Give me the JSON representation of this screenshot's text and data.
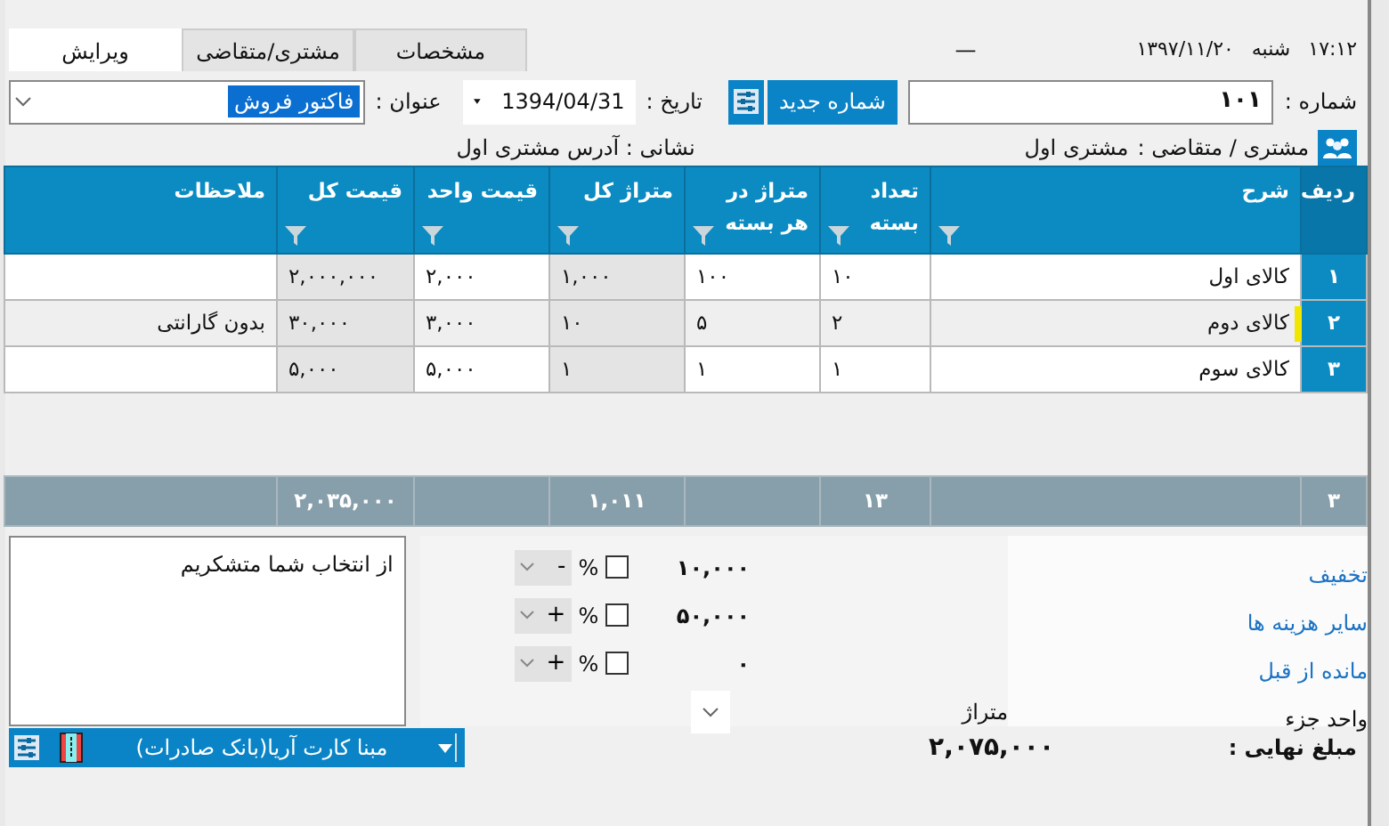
{
  "header": {
    "time": "۱۷:۱۲",
    "weekday": "شنبه",
    "date": "۱۳۹۷/۱۱/۲۰",
    "minimize": "—"
  },
  "tabs": [
    {
      "label": "مشخصات",
      "selected": false
    },
    {
      "label": "مشتری/متقاضی",
      "selected": false
    },
    {
      "label": "ویرایش",
      "selected": true
    }
  ],
  "form": {
    "number_label": "شماره :",
    "number": "۱۰۱",
    "new_number_button": "شماره جدید",
    "date_label": "تاریخ :",
    "date": "1394/04/31",
    "title_label": "عنوان :",
    "title": "فاکتور فروش",
    "customer_label": "مشتری / متقاضی :",
    "customer": "مشتری اول",
    "address_label": "نشانی :",
    "address": "آدرس مشتری اول"
  },
  "table": {
    "columns": [
      {
        "title": "ردیف",
        "filter": false,
        "computed": false
      },
      {
        "title": "شرح",
        "filter": true,
        "computed": false
      },
      {
        "title": "تعداد بسته",
        "filter": true,
        "computed": false
      },
      {
        "title": "متراژ در هر بسته",
        "filter": true,
        "computed": false
      },
      {
        "title": "متراژ کل",
        "filter": true,
        "computed": true
      },
      {
        "title": "قیمت واحد",
        "filter": true,
        "computed": false
      },
      {
        "title": "قیمت کل",
        "filter": true,
        "computed": true
      },
      {
        "title": "ملاحظات",
        "filter": false,
        "computed": false
      }
    ],
    "totals": {
      "row_count": "۳",
      "packs": "۱۳",
      "total_area": "۱,۰۱۱",
      "total_price": "۲,۰۳۵,۰۰۰"
    },
    "rows": [
      {
        "selected": false,
        "cells": [
          "۱",
          "کالای اول",
          "۱۰",
          "۱۰۰",
          "۱,۰۰۰",
          "۲,۰۰۰",
          "۲,۰۰۰,۰۰۰",
          null
        ]
      },
      {
        "selected": true,
        "cells": [
          "۲",
          "کالای دوم",
          "۲",
          "۵",
          "۱۰",
          "۳,۰۰۰",
          "۳۰,۰۰۰",
          "بدون گارانتی"
        ]
      },
      {
        "selected": false,
        "cells": [
          "۳",
          "کالای سوم",
          "۱",
          "۱",
          "۱",
          "۵,۰۰۰",
          "۵,۰۰۰",
          null
        ]
      }
    ]
  },
  "adjustments": [
    {
      "label": "تخفیف",
      "amount": "۱۰,۰۰۰",
      "percent": false,
      "percent_symbol": "%",
      "sign": "-"
    },
    {
      "label": "سایر هزینه ها",
      "amount": "۵۰,۰۰۰",
      "percent": false,
      "percent_symbol": "%",
      "sign": "+"
    },
    {
      "label": "مانده از قبل",
      "amount": "۰",
      "percent": false,
      "percent_symbol": "%",
      "sign": "+"
    }
  ],
  "unit": {
    "label": "واحد جزء",
    "value": "متراژ"
  },
  "notes": "از انتخاب شما متشکریم",
  "final": {
    "label": "مبلغ نهایی :",
    "amount": "۲,۰۷۵,۰۰۰"
  },
  "payment": {
    "account": "مبنا کارت آریا(بانک صادرات)"
  }
}
